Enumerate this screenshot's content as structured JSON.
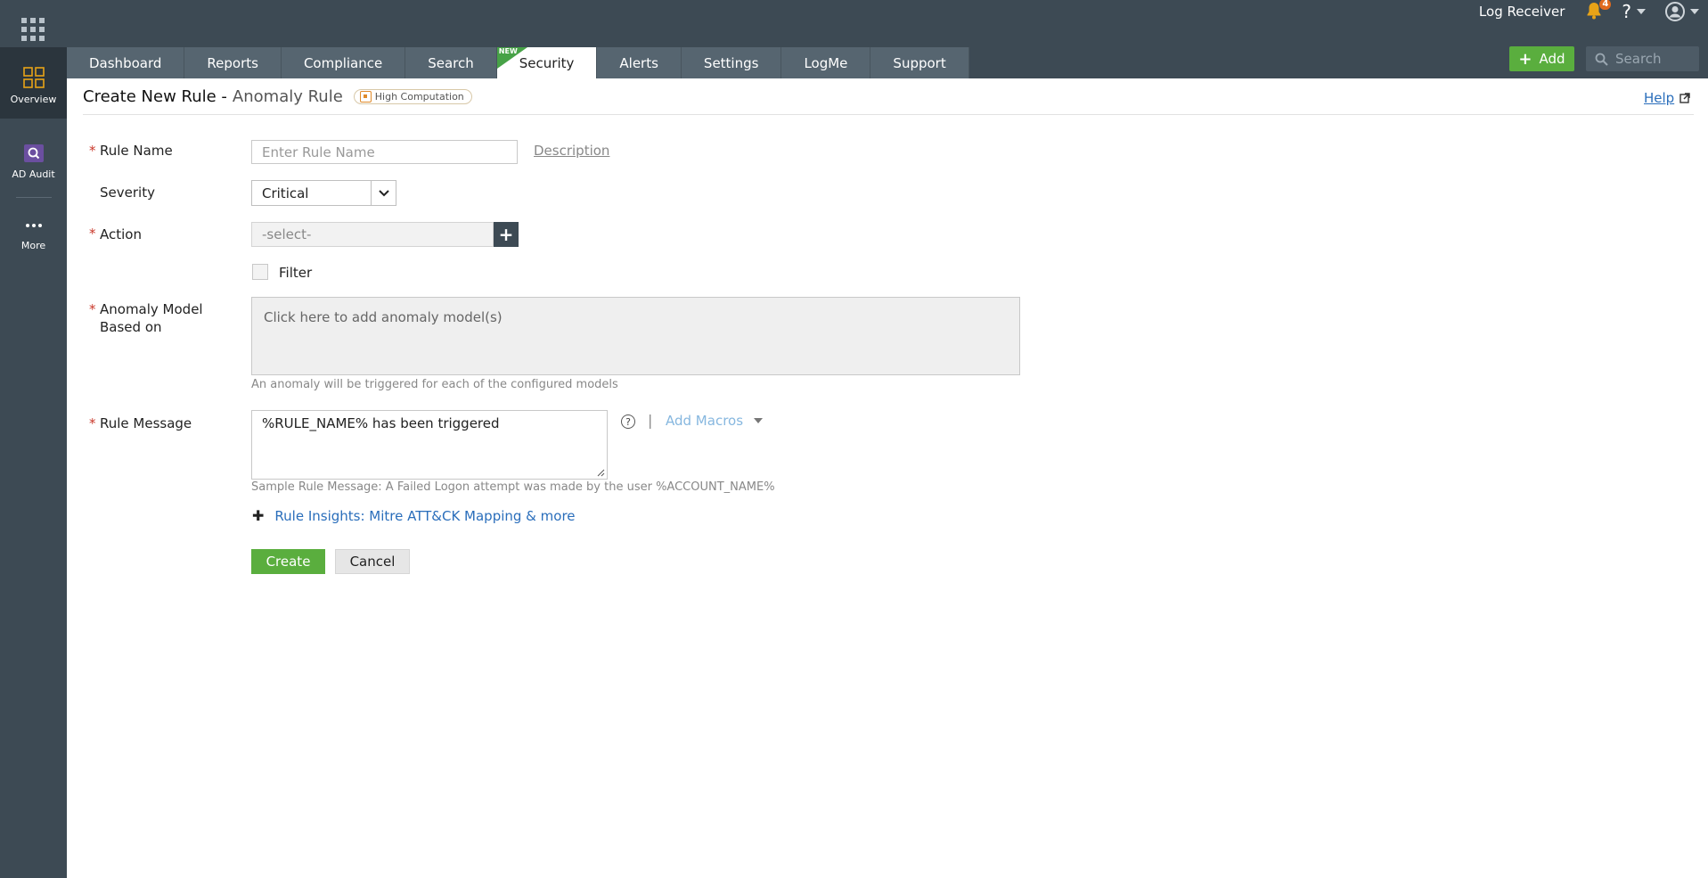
{
  "topbar": {
    "receiver": "Log Receiver",
    "notification_count": "4",
    "help": "?"
  },
  "nav": {
    "tabs": [
      {
        "label": "Dashboard"
      },
      {
        "label": "Reports"
      },
      {
        "label": "Compliance"
      },
      {
        "label": "Search"
      },
      {
        "label": "Security",
        "flag": "NEW"
      },
      {
        "label": "Alerts"
      },
      {
        "label": "Settings"
      },
      {
        "label": "LogMe"
      },
      {
        "label": "Support"
      }
    ],
    "active_tab": "Security",
    "add_label": "Add",
    "search_placeholder": "Search"
  },
  "sidebar": {
    "items": [
      {
        "label": "Overview",
        "icon": "overview-grid-icon"
      },
      {
        "label": "AD Audit",
        "icon": "ad-audit-icon"
      },
      {
        "label": "More",
        "icon": "more-dots-icon"
      }
    ]
  },
  "page": {
    "title": "Create New Rule -",
    "subtitle": "Anomaly Rule",
    "badge": "High Computation",
    "help": "Help"
  },
  "form": {
    "rule_name_label": "Rule Name",
    "rule_name_placeholder": "Enter Rule Name",
    "description_link": "Description",
    "severity_label": "Severity",
    "severity_value": "Critical",
    "action_label": "Action",
    "action_value": "-select-",
    "filter_label": "Filter",
    "anomaly_label_1": "Anomaly Model",
    "anomaly_label_2": "Based on",
    "anomaly_placeholder": "Click here to add anomaly model(s)",
    "anomaly_hint": "An anomaly will be triggered for each of the configured models",
    "rule_message_label": "Rule Message",
    "rule_message_value": "%RULE_NAME% has been triggered",
    "add_macros": "Add Macros",
    "sample_message": "Sample Rule Message: A Failed Logon attempt was made by the user %ACCOUNT_NAME%",
    "insights_link": "Rule Insights: Mitre ATT&CK Mapping & more",
    "create_label": "Create",
    "cancel_label": "Cancel"
  },
  "colors": {
    "topbar": "#3d4a54",
    "accent_green": "#5aae3e",
    "link_blue": "#2a6ebb",
    "required_red": "#c9382a"
  }
}
